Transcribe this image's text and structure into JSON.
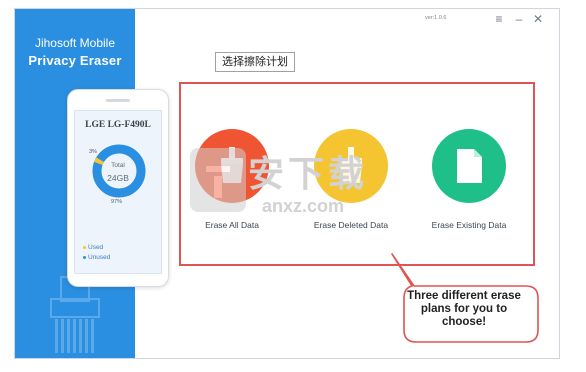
{
  "app": {
    "title_line1": "Jihosoft Mobile",
    "title_line2": "Privacy Eraser",
    "version": "ver:1.0.6"
  },
  "window_controls": {
    "menu_icon": "≡",
    "minimize_icon": "–",
    "close_icon": "✕"
  },
  "device": {
    "name": "LGE LG-F490L",
    "storage_label": "Total",
    "storage_total": "24GB",
    "used_percent_label": "3%",
    "unused_percent_label": "97%",
    "used_fraction": 0.03,
    "legend_used": "Used",
    "legend_unused": "Unused",
    "colors": {
      "used": "#f5c431",
      "unused": "#2a8fe0"
    }
  },
  "plans": {
    "section_tag": "选择擦除计划",
    "items": [
      {
        "label": "Erase All Data",
        "color": "#f05533",
        "icon": "brush-icon"
      },
      {
        "label": "Erase Deleted Data",
        "color": "#f5c431",
        "icon": "brush-icon"
      },
      {
        "label": "Erase Existing Data",
        "color": "#1fbf8a",
        "icon": "document-icon"
      }
    ]
  },
  "callout": {
    "text": "Three different erase plans for you to choose!"
  },
  "watermark": {
    "text": "安下载",
    "sub": "anxz.com"
  },
  "colors": {
    "sidebar": "#2a8fe0",
    "highlight_border": "#e05454"
  }
}
